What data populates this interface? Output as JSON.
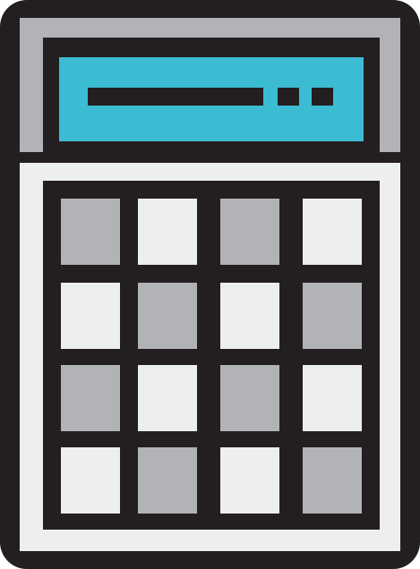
{
  "icon": {
    "name": "calculator-icon",
    "colors": {
      "outline": "#231f20",
      "body_top": "#b1b3b6",
      "body_bottom": "#eceeef",
      "screen": "#3cbcd3",
      "key_dark": "#b1b3b6",
      "key_light": "#eceeef"
    },
    "keypad": {
      "rows": [
        [
          "dark",
          "light",
          "dark",
          "light"
        ],
        [
          "light",
          "dark",
          "light",
          "dark"
        ],
        [
          "dark",
          "light",
          "dark",
          "light"
        ],
        [
          "light",
          "dark",
          "light",
          "dark"
        ]
      ]
    }
  }
}
